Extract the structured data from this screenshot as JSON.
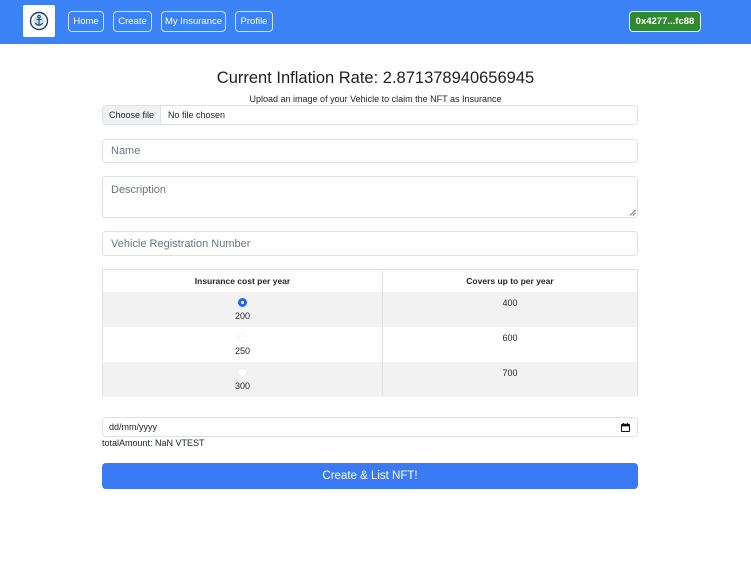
{
  "nav": {
    "links": [
      "Home",
      "Create",
      "My Insurance",
      "Profile"
    ],
    "wallet": "0x4277...fc88"
  },
  "page": {
    "title": "Current Inflation Rate: 2.871378940656945",
    "subtitle": "Upload an image of your Vehicle to claim the NFT as Insurance"
  },
  "file": {
    "button": "Choose file",
    "status": "No file chosen"
  },
  "form": {
    "name_placeholder": "Name",
    "description_placeholder": "Description",
    "registration_placeholder": "Vehicle Registration Number"
  },
  "table": {
    "headers": [
      "Insurance cost per year",
      "Covers up to per year"
    ],
    "rows": [
      {
        "cost": "200",
        "covers": "400",
        "selected": true
      },
      {
        "cost": "250",
        "covers": "600",
        "selected": false
      },
      {
        "cost": "300",
        "covers": "700",
        "selected": false
      }
    ]
  },
  "date": {
    "placeholder": "dd/mm/yyyy"
  },
  "total_amount": "totalAmount: NaN VTEST",
  "submit_label": "Create & List NFT!",
  "colors": {
    "navbar": "#3b82f6",
    "wallet": "#2f8a2f",
    "submit": "#3b7af5",
    "radio_checked": "#2563eb"
  },
  "icons": {
    "logo": "anchor-logo-icon",
    "date": "calendar-icon"
  }
}
